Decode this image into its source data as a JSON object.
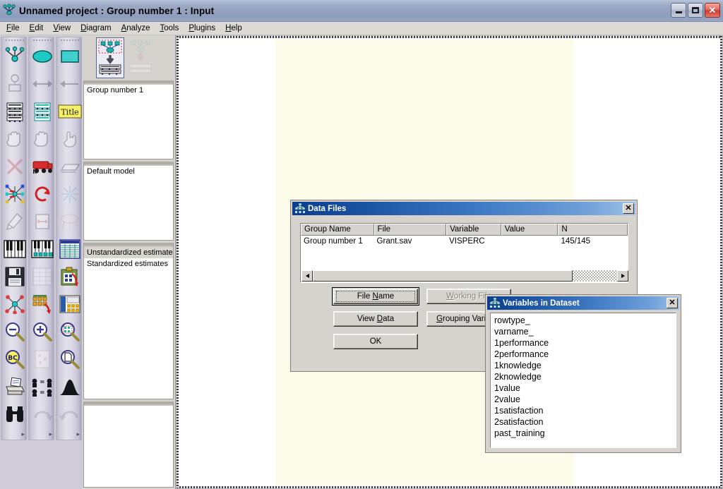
{
  "window": {
    "title": "Unnamed project : Group number 1 : Input",
    "icon": "amos-graphics-icon",
    "buttons": {
      "minimize": "–",
      "maximize": "□",
      "close": "✕"
    }
  },
  "menubar": {
    "items": [
      {
        "label": "File",
        "accel": "F",
        "name": "menu-file"
      },
      {
        "label": "Edit",
        "accel": "E",
        "name": "menu-edit"
      },
      {
        "label": "View",
        "accel": "V",
        "name": "menu-view"
      },
      {
        "label": "Diagram",
        "accel": "D",
        "name": "menu-diagram"
      },
      {
        "label": "Analyze",
        "accel": "A",
        "name": "menu-analyze"
      },
      {
        "label": "Tools",
        "accel": "T",
        "name": "menu-tools"
      },
      {
        "label": "Plugins",
        "accel": "P",
        "name": "menu-plugins"
      },
      {
        "label": "Help",
        "accel": "H",
        "name": "menu-help"
      }
    ]
  },
  "palette": {
    "columns": [
      {
        "footer": "▸",
        "tools": [
          "draw-observed-variable-icon",
          "draw-latent-variable-icon",
          "draw-path-icon",
          "move-objects-hand-icon",
          "erase-objects-x-icon",
          "select-all-objects-icon",
          "touch-up-variable-icon",
          "list-variables-in-model-icon",
          "save-diagram-icon",
          "analysis-properties-icon",
          "zoom-out-icon",
          "object-properties-icon",
          "print-diagram-icon",
          "search-binoculars-icon"
        ]
      },
      {
        "footer": "▸",
        "tools": [
          "draw-unobserved-variable-icon",
          "draw-covariance-double-arrow-icon",
          "list-variables-in-dataset-icon",
          "duplicate-objects-hand-icon",
          "select-data-file-icon",
          "rotate-indicators-icon",
          "move-parameter-values-icon",
          "list-variables-in-dataset-2-icon",
          "display-output-table-icon",
          "multiple-group-analysis-icon",
          "zoom-in-icon",
          "resize-diagram-to-page-icon",
          "preserve-symmetries-icon",
          "redo-icon"
        ]
      },
      {
        "footer": "▸",
        "tools": [
          "draw-rectangle-variable-icon",
          "draw-single-arrow-icon",
          "figure-caption-title-icon",
          "move-single-object-icon",
          "reshape-object-icon",
          "deselect-all-objects-icon",
          "drag-properties-icon",
          "view-text-output-icon",
          "object-properties-clipboard-icon",
          "copy-to-clipboard-icon",
          "view-model-in-magnifier-icon",
          "fit-to-page-icon",
          "bayesian-estimation-icon",
          "undo-icon"
        ]
      }
    ]
  },
  "tree_panel": {
    "view_icons": [
      {
        "name": "view-input-path-diagram-icon",
        "selected": true
      },
      {
        "name": "view-output-path-diagram-icon",
        "selected": false
      }
    ],
    "groups_box": {
      "name": "groups-list",
      "items": [
        {
          "label": "Group number 1",
          "selected": false
        }
      ]
    },
    "models_box": {
      "name": "models-list",
      "items": [
        {
          "label": "Default model",
          "selected": false
        }
      ]
    },
    "estimates_box": {
      "name": "estimates-list",
      "items": [
        {
          "label": "Unstandardized estimates",
          "selected": true
        },
        {
          "label": "Standardized estimates",
          "selected": false
        }
      ]
    }
  },
  "data_files_dialog": {
    "title": "Data Files",
    "icon": "amos-graphics-icon",
    "close_label": "✕",
    "grid": {
      "columns": [
        "Group Name",
        "File",
        "Variable",
        "Value",
        "N"
      ],
      "rows": [
        {
          "group_name": "Group number 1",
          "file": "Grant.sav",
          "variable": "VISPERC",
          "value": "",
          "n": "145/145"
        }
      ]
    },
    "buttons": [
      {
        "label": "File Name",
        "accel": "N",
        "name": "file-name-button",
        "enabled": true,
        "default": true
      },
      {
        "label": "Working File",
        "accel": "W",
        "name": "working-file-button",
        "enabled": false,
        "default": false
      },
      {
        "label": "View Data",
        "accel": "D",
        "name": "view-data-button",
        "enabled": true,
        "default": false
      },
      {
        "label": "Grouping Variable",
        "accel": "G",
        "name": "grouping-variable-button",
        "enabled": true,
        "default": false
      },
      {
        "label": "OK",
        "accel": "",
        "name": "ok-button",
        "enabled": true,
        "default": false
      }
    ]
  },
  "variables_dialog": {
    "title": "Variables in Dataset",
    "icon": "amos-graphics-icon",
    "close_label": "✕",
    "variables": [
      "rowtype_",
      "varname_",
      "1performance",
      "2performance",
      "1knowledge",
      "2knowledge",
      "1value",
      "2value",
      "1satisfaction",
      "2satisfaction",
      "past_training"
    ]
  },
  "colors": {
    "titlebar_active": "#0b3c8e",
    "dialog_face": "#d6d3ce",
    "canvas_page": "#fdfceb",
    "palette_bg": "#cfccd8",
    "teal_shape": "#3fd1cf",
    "title_box_yellow": "#f7f07a"
  }
}
